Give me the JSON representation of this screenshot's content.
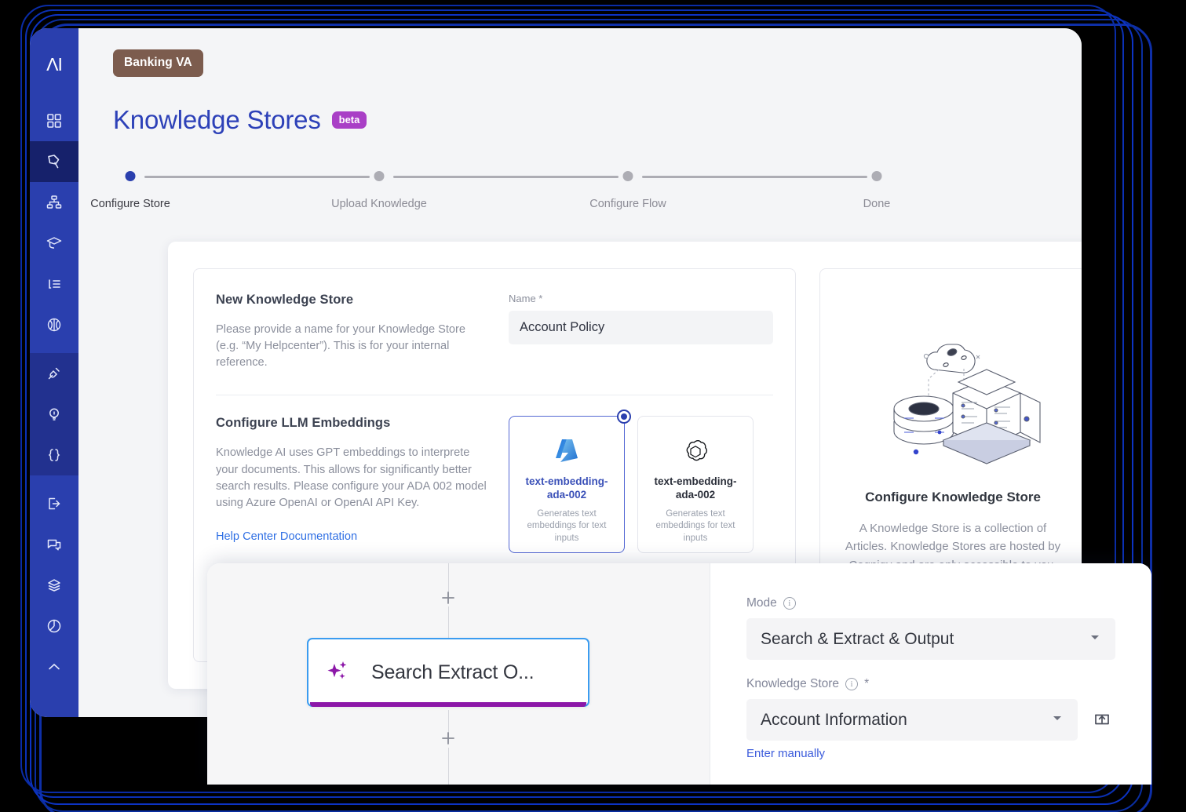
{
  "app": {
    "logo_text": "ΛI",
    "sidebar_items": [
      {
        "name": "dashboard",
        "icon": "grid-icon"
      },
      {
        "name": "flows",
        "icon": "flow-pin-icon",
        "active": true
      },
      {
        "name": "intents",
        "icon": "sitemap-icon"
      },
      {
        "name": "training",
        "icon": "graduation-cap-icon"
      },
      {
        "name": "lexicons",
        "icon": "list-icon"
      },
      {
        "name": "knowledge-ai",
        "icon": "brain-icon"
      },
      {
        "name": "extensions",
        "icon": "plug-icon"
      },
      {
        "name": "insights",
        "icon": "lightbulb-icon"
      },
      {
        "name": "code",
        "icon": "braces-icon"
      },
      {
        "name": "endpoints",
        "icon": "logout-icon"
      },
      {
        "name": "conversations",
        "icon": "chat-icon"
      },
      {
        "name": "layers",
        "icon": "layers-icon"
      },
      {
        "name": "analytics",
        "icon": "pie-chart-icon"
      },
      {
        "name": "more",
        "icon": "chevron-up-icon"
      }
    ]
  },
  "header": {
    "project_chip": "Banking VA",
    "title": "Knowledge Stores",
    "badge": "beta"
  },
  "stepper": {
    "steps": [
      {
        "label": "Configure Store",
        "active": true
      },
      {
        "label": "Upload Knowledge",
        "active": false
      },
      {
        "label": "Configure Flow",
        "active": false
      },
      {
        "label": "Done",
        "active": false
      }
    ]
  },
  "form": {
    "new_store": {
      "title": "New Knowledge Store",
      "description": "Please provide a name for your Knowledge Store (e.g. “My Helpcenter”). This is for your internal reference.",
      "name_label": "Name *",
      "name_value": "Account Policy",
      "name_placeholder": "Name"
    },
    "embeddings": {
      "title": "Configure LLM Embeddings",
      "description": "Knowledge AI uses GPT embeddings to interprete your documents. This allows for significantly better search results. Please configure your ADA 002 model using Azure OpenAI or OpenAI API Key.",
      "help_link": "Help Center Documentation",
      "models": [
        {
          "name": "text-embedding-ada-002",
          "name_line1": "text-embedding-",
          "name_line2": "ada-002",
          "description": "Generates text embeddings for text inputs",
          "provider": "azure",
          "icon": "azure-logo-icon",
          "selected": true
        },
        {
          "name": "text-embedding-ada-002",
          "name_line1": "text-embedding-",
          "name_line2": "ada-002",
          "description": "Generates text embeddings for text inputs",
          "provider": "openai",
          "icon": "openai-logo-icon",
          "selected": false
        }
      ]
    }
  },
  "info_panel": {
    "illustration": "knowledge-store-illustration",
    "title": "Configure Knowledge Store",
    "description": "A Knowledge Store is a collection of Articles. Knowledge Stores are hosted by Cognigy and are only accessible to you."
  },
  "overlay": {
    "flow": {
      "node_label": "Search Extract O...",
      "node_icon": "sparkle-icon",
      "add_top": "+",
      "add_bottom": "+"
    },
    "side_form": {
      "mode_label": "Mode",
      "mode_value": "Search & Extract & Output",
      "store_label": "Knowledge Store",
      "store_required": "*",
      "store_value": "Account Information",
      "enter_manually": "Enter manually",
      "open_icon": "external-open-icon",
      "info_icon": "info-icon",
      "caret_icon": "chevron-down-icon"
    }
  },
  "colors": {
    "sidebar": "#2a3fae",
    "sidebar_active": "#16216b",
    "title": "#2d41b8",
    "beta": "#a93fc6",
    "chip": "#7c5c4e",
    "frame": "#0c33c4",
    "node_border": "#3b9cf0",
    "node_accent": "#8c17a8",
    "link": "#2f6fe4"
  }
}
